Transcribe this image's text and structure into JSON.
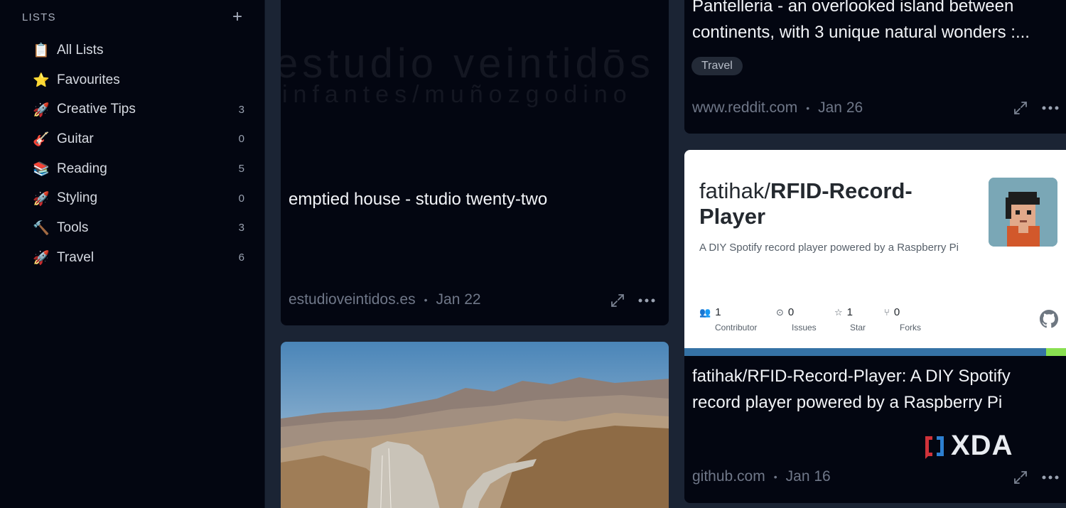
{
  "sidebar": {
    "title": "LISTS",
    "add_icon": "plus-icon",
    "items": [
      {
        "emoji": "📋",
        "label": "All Lists",
        "count": ""
      },
      {
        "emoji": "⭐",
        "label": "Favourites",
        "count": ""
      },
      {
        "emoji": "🚀",
        "label": "Creative Tips",
        "count": "3"
      },
      {
        "emoji": "🎸",
        "label": "Guitar",
        "count": "0"
      },
      {
        "emoji": "📚",
        "label": "Reading",
        "count": "5"
      },
      {
        "emoji": "🚀",
        "label": "Styling",
        "count": "0"
      },
      {
        "emoji": "🔨",
        "label": "Tools",
        "count": "3"
      },
      {
        "emoji": "🚀",
        "label": "Travel",
        "count": "6"
      }
    ]
  },
  "cards": {
    "house": {
      "logo_line1": "estudio veintidōs",
      "logo_line2": "infantes/muñozgodino",
      "title": "emptied house - studio twenty-two",
      "domain": "estudioveintidos.es",
      "date": "Jan 22"
    },
    "pantelleria": {
      "title": "Pantelleria - an overlooked island between continents, with 3 unique natural wonders :...",
      "tag": "Travel",
      "domain": "www.reddit.com",
      "date": "Jan 26"
    },
    "github": {
      "owner": "fatihak/",
      "repo": "RFID-Record-Player",
      "description": "A DIY Spotify record player powered by a Raspberry Pi",
      "stats": [
        {
          "icon": "people-icon",
          "value": "1",
          "label": "Contributor"
        },
        {
          "icon": "issue-icon",
          "value": "0",
          "label": "Issues"
        },
        {
          "icon": "star-icon",
          "value": "1",
          "label": "Star"
        },
        {
          "icon": "fork-icon",
          "value": "0",
          "label": "Forks"
        }
      ],
      "title": "fatihak/RFID-Record-Player: A DIY Spotify record player powered by a Raspberry Pi",
      "domain": "github.com",
      "date": "Jan 16"
    },
    "road": {
      "image": "mountain-road-photo"
    }
  },
  "watermark": "XDA",
  "colors": {
    "background": "#1b2434",
    "card": "#030611",
    "sidebar": "#030611",
    "github_bar_blue": "#3572a5",
    "github_bar_green": "#89e051"
  }
}
